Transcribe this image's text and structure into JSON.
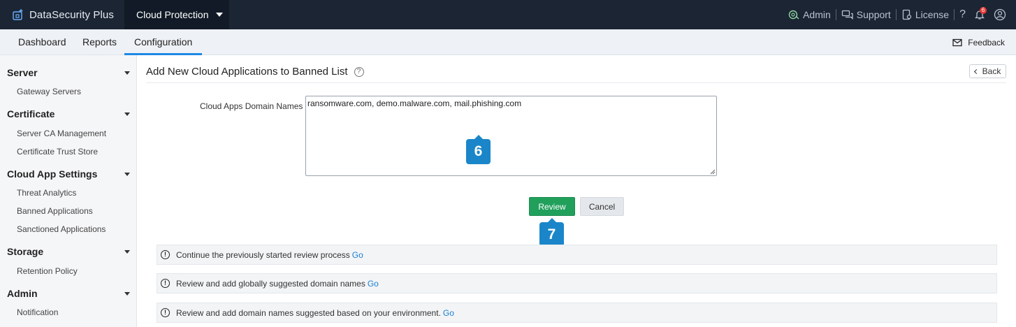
{
  "header": {
    "brand": "DataSecurity Plus",
    "product": "Cloud Protection",
    "links": {
      "admin": "Admin",
      "support": "Support",
      "license": "License",
      "help": "?"
    },
    "notifications_count": "6"
  },
  "tabs": {
    "dashboard": "Dashboard",
    "reports": "Reports",
    "configuration": "Configuration"
  },
  "feedback": "Feedback",
  "sidebar": {
    "server": {
      "title": "Server",
      "items": [
        "Gateway Servers"
      ]
    },
    "certificate": {
      "title": "Certificate",
      "items": [
        "Server CA Management",
        "Certificate Trust Store"
      ]
    },
    "cloud_app_settings": {
      "title": "Cloud App Settings",
      "items": [
        "Threat Analytics",
        "Banned Applications",
        "Sanctioned Applications"
      ]
    },
    "storage": {
      "title": "Storage",
      "items": [
        "Retention Policy"
      ]
    },
    "admin": {
      "title": "Admin",
      "items": [
        "Notification"
      ]
    }
  },
  "main": {
    "title": "Add New Cloud Applications to Banned List",
    "back_label": "Back",
    "field_label": "Cloud Apps Domain Names",
    "domain_value": "ransomware.com, demo.malware.com, mail.phishing.com",
    "review_label": "Review",
    "cancel_label": "Cancel",
    "step_markers": [
      "6",
      "7"
    ],
    "info_rows": [
      {
        "text": "Continue the previously started review process",
        "link": "Go"
      },
      {
        "text": "Review and add globally suggested domain names",
        "link": "Go"
      },
      {
        "text": "Review and add domain names suggested based on your environment.",
        "link": "Go"
      }
    ]
  },
  "colors": {
    "topbar": "#1b2533",
    "accent": "#1e88e5",
    "review_button": "#21a05c",
    "step_marker": "#1a86c9"
  }
}
